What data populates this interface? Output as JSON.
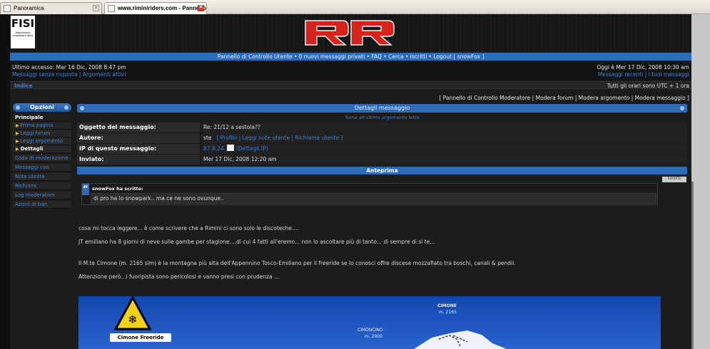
{
  "browser": {
    "tabs": [
      {
        "title": "Panoramica",
        "active": false
      },
      {
        "title": "www.riminiriders.com - Pannello ...",
        "active": true
      }
    ]
  },
  "header": {
    "fisi_logo": {
      "letters": "FISI",
      "caption": "federazione snowboard italia"
    },
    "site_logo_text": "RR"
  },
  "navbar": "Pannello di Controllo Utente • 0 nuovi messaggi privati • FAQ • Cerca • Iscritti • Logout [ snowFox ]",
  "info": {
    "last_access": "Ultimo accesso: Mar 16 Dic, 2008 8:47 pm",
    "left_links": "Messaggi senza risposta | Argomenti attivi",
    "today": "Oggi è Mer 17 Dic, 2008 10:30 am",
    "right_links": "Messaggi recenti | I tuoi messaggi"
  },
  "breadcrumb": {
    "index": "Indice",
    "timezone": "Tutti gli orari sono UTC + 1 ora"
  },
  "mod_links": "[ Pannello di Controllo Moderatore | Modera forum | Modera argomento | Modera messaggio ]",
  "sidebar": {
    "title": "Opzioni",
    "items": [
      {
        "label": "Principale",
        "type": "heading"
      },
      {
        "label": "Prima pagina",
        "type": "sub"
      },
      {
        "label": "Leggi forum",
        "type": "sub"
      },
      {
        "label": "Leggi argomento",
        "type": "sub"
      },
      {
        "label": "Dettagli messaggio",
        "type": "current"
      },
      {
        "label": "Coda di moderazione",
        "type": "link"
      },
      {
        "label": "Messaggi con rapporto",
        "type": "link"
      },
      {
        "label": "Note utente",
        "type": "link"
      },
      {
        "label": "Richiami",
        "type": "link"
      },
      {
        "label": "Log moderatore",
        "type": "link"
      },
      {
        "label": "Azioni di ban",
        "type": "link"
      }
    ]
  },
  "details": {
    "title": "Dettagli messaggio",
    "back_link": "Torna all'ultimo argomento letto",
    "rows": [
      {
        "key": "Oggetto del messaggio:",
        "value": "Re: 21/12 a sestola??"
      },
      {
        "key": "Autore:",
        "value": "ste",
        "links": "[ Profilo | Leggi note utente | Richiama utente ]"
      },
      {
        "key": "IP di questo messaggio:",
        "value": "87.6.24.",
        "links": "(Dettagli IP)"
      },
      {
        "key": "Inviato:",
        "value": "Mer 17 Dic, 2008 12:20 am"
      }
    ]
  },
  "preview": {
    "title": "Anteprima",
    "mini_button": "RIPORTA",
    "quote_author": "snowFox ha scritto:",
    "quote_text": "di pro ha lo snowpark.. ma ce ne sono ovunque..",
    "paragraphs": [
      "cosa mi tocca leggere... è come scrivere che a Rimini ci sono solo le discoteche....",
      "JT emiliano ha 8 giorni di neve sulle gambe per stagione....di cui 4 fatti all'eremo... non lo ascoltare più di tanto... di sempre di sì te...",
      "Il M.te Cimone (m. 2165 slm) è la montagna più alta dell'Appennino Tosco-Emiliano per il freeride se lo conosci offre discese mozzafiato tra boschi, canali & pendii.",
      "Attenzione però...i fuoripista sono pericolosi e vanno presi con prudenza ..."
    ],
    "map": {
      "sign_text": "Cimone Freeride",
      "peak1_name": "CIMONE",
      "peak1_alt": "m. 2165",
      "peak2_name": "CIMONCINO",
      "peak2_alt": "m. 2000"
    }
  }
}
